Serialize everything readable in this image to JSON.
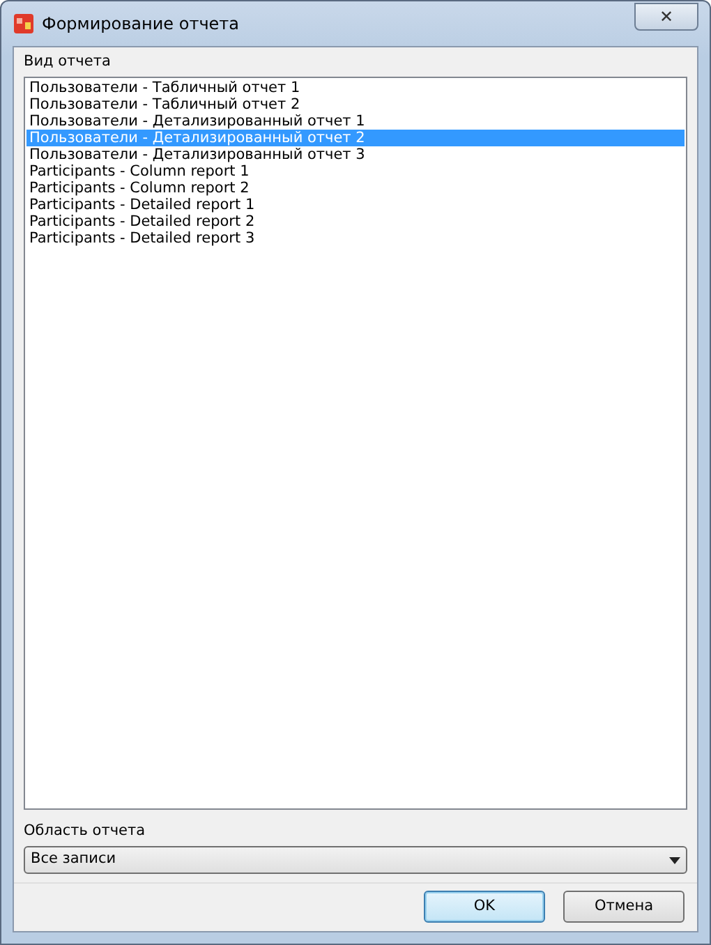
{
  "window": {
    "title": "Формирование отчета",
    "close": "✕"
  },
  "report_type": {
    "label": "Вид отчета",
    "items": [
      {
        "text": "Пользователи - Табличный отчет 1",
        "selected": false
      },
      {
        "text": "Пользователи - Табличный отчет 2",
        "selected": false
      },
      {
        "text": "Пользователи - Детализированный отчет 1",
        "selected": false
      },
      {
        "text": "Пользователи - Детализированный отчет 2",
        "selected": true
      },
      {
        "text": "Пользователи - Детализированный отчет 3",
        "selected": false
      },
      {
        "text": "Participants - Column report 1",
        "selected": false
      },
      {
        "text": "Participants - Column report 2",
        "selected": false
      },
      {
        "text": "Participants - Detailed report 1",
        "selected": false
      },
      {
        "text": "Participants - Detailed report 2",
        "selected": false
      },
      {
        "text": "Participants - Detailed report 3",
        "selected": false
      }
    ]
  },
  "report_scope": {
    "label": "Область отчета",
    "value": "Все записи"
  },
  "buttons": [
    {
      "label": "OK",
      "default": true
    },
    {
      "label": "Отмена",
      "default": false
    }
  ]
}
